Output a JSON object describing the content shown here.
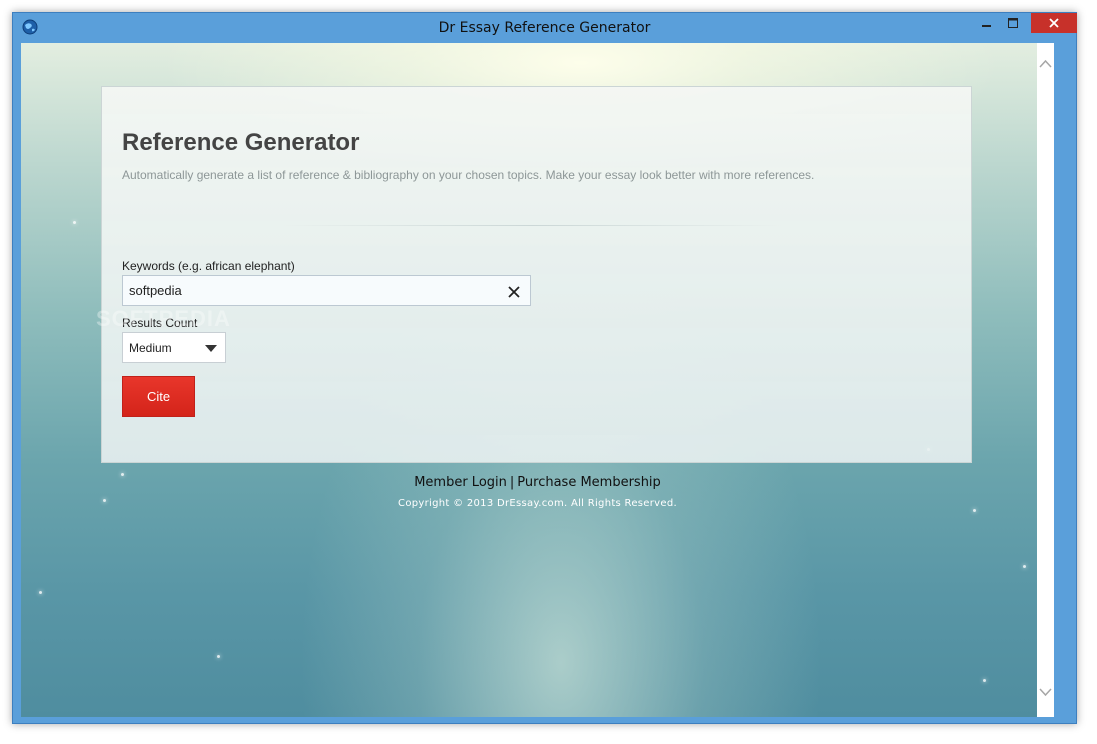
{
  "window": {
    "title": "Dr Essay Reference Generator"
  },
  "card": {
    "title": "Reference Generator",
    "description": "Automatically generate a list of reference & bibliography on your chosen topics. Make your essay look better with more references."
  },
  "keywords": {
    "label": "Keywords (e.g. african elephant)",
    "value": "softpedia"
  },
  "results_count": {
    "label": "Results Count",
    "selected": "Medium"
  },
  "cite_button": {
    "label": "Cite"
  },
  "footer": {
    "member_login": "Member Login",
    "separator": "|",
    "purchase_membership": "Purchase Membership",
    "copyright": "Copyright © 2013 DrEssay.com. All Rights Reserved."
  },
  "watermark": "SOFTPEDIA",
  "colors": {
    "close_button": "#c7312a",
    "cite_button": "#d4241a",
    "window_frame": "#5a9fda"
  },
  "icons": {
    "app": "globe-icon",
    "clear": "close-x-icon",
    "dropdown": "triangle-down-icon"
  }
}
